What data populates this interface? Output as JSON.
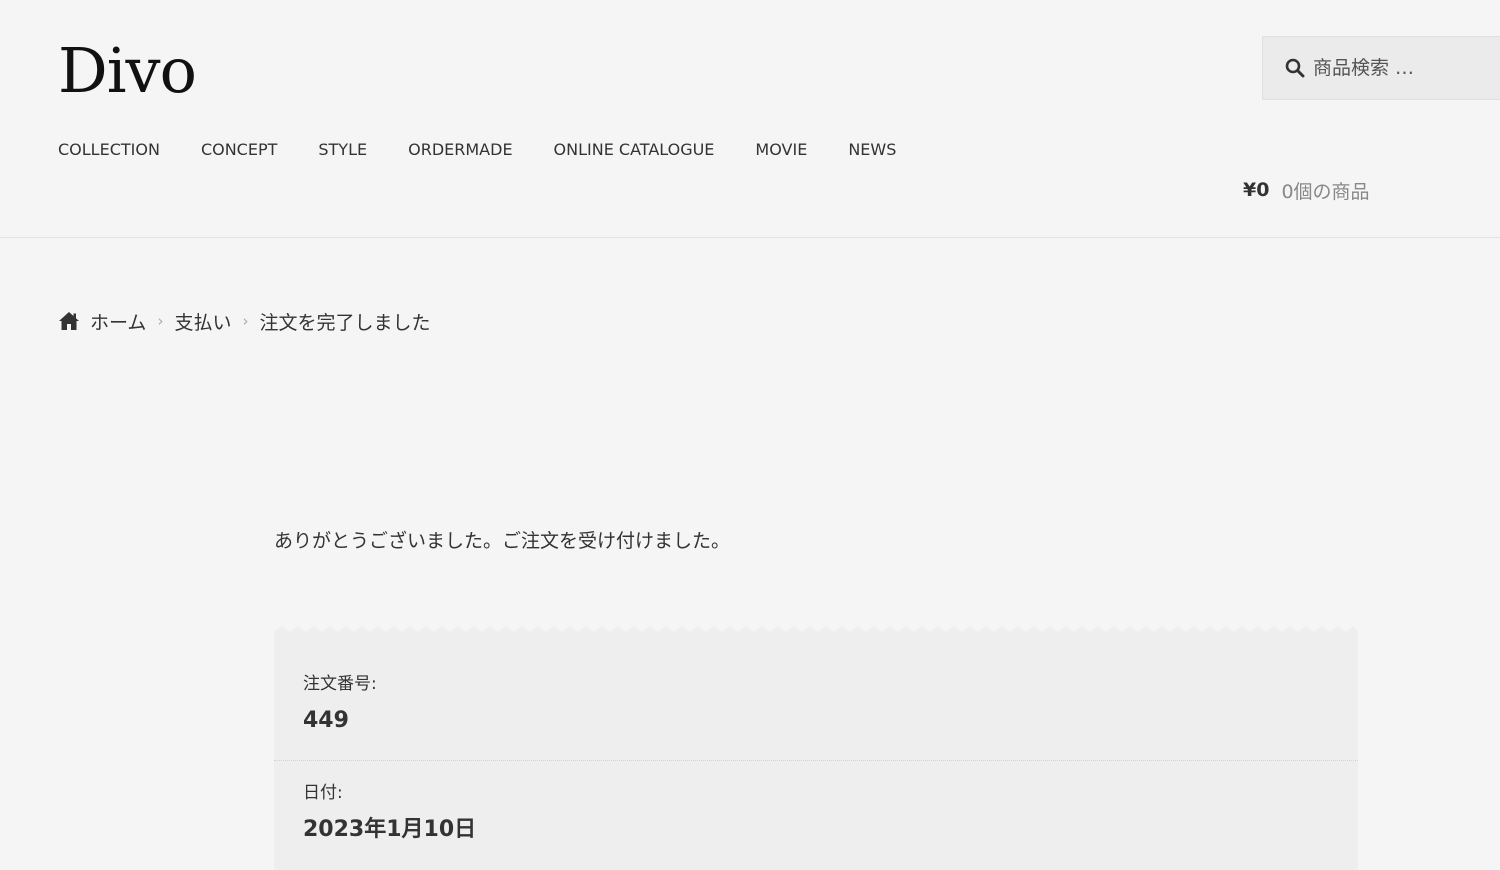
{
  "header": {
    "logo": "Divo",
    "search": {
      "placeholder": "商品検索 …"
    },
    "nav": [
      "COLLECTION",
      "CONCEPT",
      "STYLE",
      "ORDERMADE",
      "ONLINE CATALOGUE",
      "MOVIE",
      "NEWS"
    ],
    "cart": {
      "amount": "¥0",
      "count": "0個の商品"
    }
  },
  "breadcrumb": {
    "home": "ホーム",
    "items": [
      "支払い",
      "注文を完了しました"
    ],
    "separator": "›"
  },
  "thank_you": "ありがとうございました。ご注文を受け付けました。",
  "order": {
    "number_label": "注文番号:",
    "number_value": "449",
    "date_label": "日付:",
    "date_value": "2023年1月10日"
  },
  "colors": {
    "background": "#f5f5f5",
    "panel": "#eeeeee",
    "text": "#333333",
    "muted": "#888888"
  },
  "icons": {
    "search": "search-icon",
    "home": "home-icon"
  }
}
